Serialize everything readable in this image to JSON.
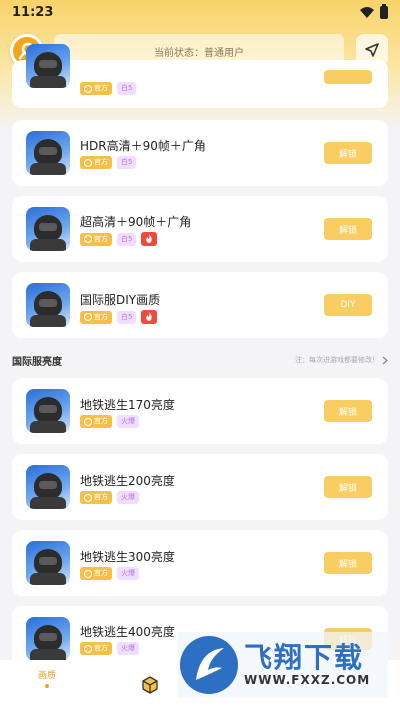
{
  "status_bar": {
    "time": "11:23"
  },
  "header": {
    "status_text": "当前状态：普通用户"
  },
  "cards": [
    {
      "title": "",
      "tags": [
        "官方",
        "白5"
      ],
      "hot": false,
      "action": ""
    },
    {
      "title": "HDR高清＋90帧＋广角",
      "tags": [
        "官方",
        "白5"
      ],
      "hot": false,
      "action": "解锁"
    },
    {
      "title": "超高清＋90帧＋广角",
      "tags": [
        "官方",
        "白5"
      ],
      "hot": true,
      "action": "解锁"
    },
    {
      "title": "国际服DIY画质",
      "tags": [
        "官方",
        "白5"
      ],
      "hot": true,
      "action": "DIY"
    },
    {
      "title": "地铁逃生170亮度",
      "tags": [
        "官方",
        "火爆"
      ],
      "hot": false,
      "action": "解锁"
    },
    {
      "title": "地铁逃生200亮度",
      "tags": [
        "官方",
        "火爆"
      ],
      "hot": false,
      "action": "解锁"
    },
    {
      "title": "地铁逃生300亮度",
      "tags": [
        "官方",
        "火爆"
      ],
      "hot": false,
      "action": "解锁"
    },
    {
      "title": "地铁逃生400亮度",
      "tags": [
        "官方",
        "火爆"
      ],
      "hot": false,
      "action": "解锁"
    }
  ],
  "section": {
    "title": "国际服亮度",
    "note": "注：每次进游戏都要修改！"
  },
  "bottom_nav": {
    "tab_quality": "画质"
  },
  "watermark": {
    "title": "飞翔下载",
    "url": "WWW.FXXZ.COM"
  },
  "colors": {
    "accent": "#f8cd62",
    "hot": "#ee4b3d",
    "tag_official": "#f5c04a"
  }
}
